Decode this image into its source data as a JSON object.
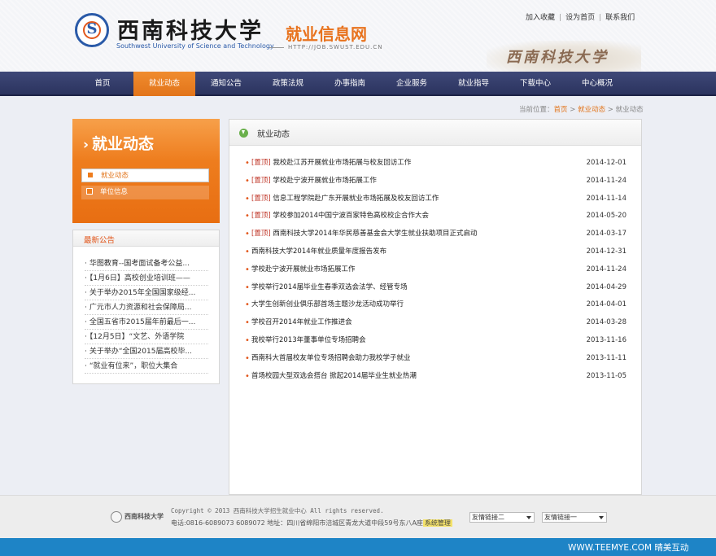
{
  "header": {
    "univ_cn": "西南科技大学",
    "univ_en": "Southwest University of Science and Technology",
    "site_name": "就业信息网",
    "site_url": "HTTP://JOB.SWUST.EDU.CN",
    "logo_letter": "S",
    "calligraphy": "西南科技大学",
    "links": [
      "加入收藏",
      "设为首页",
      "联系我们"
    ],
    "link_sep": "|"
  },
  "nav": {
    "items": [
      "首页",
      "就业动态",
      "通知公告",
      "政策法规",
      "办事指南",
      "企业服务",
      "就业指导",
      "下载中心",
      "中心概况"
    ],
    "active_index": 1
  },
  "breadcrumb": {
    "prefix": "当前位置：",
    "home": "首页",
    "sep": " > ",
    "section": "就业动态",
    "current": "就业动态"
  },
  "sidebar": {
    "title": "就业动态",
    "chevron": "›",
    "menu": [
      {
        "label": "就业动态",
        "active": true
      },
      {
        "label": "单位信息",
        "active": false
      }
    ],
    "news_title": "最新公告",
    "news": [
      "华图教育--国考面试备考公益...",
      "【1月6日】高校创业培训班——",
      "关于举办2015年全国国家级经...",
      "广元市人力资源和社会保障局...",
      "全国五省市2015届年前最后一...",
      "【12月5日】“文艺、外语学院",
      "关于举办“全国2015届高校毕...",
      "“就业有位来”，职位大集合"
    ]
  },
  "main": {
    "title": "就业动态",
    "tag": "[置顶]",
    "bullet": "•",
    "rows": [
      {
        "pinned": true,
        "title": "我校赴江苏开展就业市场拓展与校友回访工作",
        "date": "2014-12-01"
      },
      {
        "pinned": true,
        "title": "学校赴宁波开展就业市场拓展工作",
        "date": "2014-11-24"
      },
      {
        "pinned": true,
        "title": "信息工程学院赴广东开展就业市场拓展及校友回访工作",
        "date": "2014-11-14"
      },
      {
        "pinned": true,
        "title": "学校参加2014中国宁波百家特色高校校企合作大会",
        "date": "2014-05-20"
      },
      {
        "pinned": true,
        "title": "西南科技大学2014年华民慈善基金会大学生就业扶助项目正式启动",
        "date": "2014-03-17"
      },
      {
        "pinned": false,
        "title": "西南科技大学2014年就业质量年度报告发布",
        "date": "2014-12-31"
      },
      {
        "pinned": false,
        "title": "学校赴宁波开展就业市场拓展工作",
        "date": "2014-11-24"
      },
      {
        "pinned": false,
        "title": "学校举行2014届毕业生春季双选会法学、经管专场",
        "date": "2014-04-29"
      },
      {
        "pinned": false,
        "title": "大学生创新创业俱乐部首场主题沙龙活动成功举行",
        "date": "2014-04-01"
      },
      {
        "pinned": false,
        "title": "学校召开2014年就业工作推进会",
        "date": "2014-03-28"
      },
      {
        "pinned": false,
        "title": "我校举行2013年董事单位专场招聘会",
        "date": "2013-11-16"
      },
      {
        "pinned": false,
        "title": "西南科大首届校友单位专场招聘会助力我校学子就业",
        "date": "2013-11-11"
      },
      {
        "pinned": false,
        "title": "首场校园大型双选会搭台 掀起2014届毕业生就业热潮",
        "date": "2013-11-05"
      }
    ]
  },
  "footer": {
    "logo_text": "西南科技大学",
    "copyright": "Copyright © 2013 西南科技大学招生就业中心 All rights reserved.",
    "address": "电话:0816-6089073 6089072 地址：四川省绵阳市涪城区青龙大道中段59号东八A座",
    "admin_link": "系统管理",
    "select_1": "友情链接二",
    "select_2": "友情链接一"
  },
  "bottom_bar": {
    "text": "WWW.TEEMYE.COM 晴美互动"
  }
}
